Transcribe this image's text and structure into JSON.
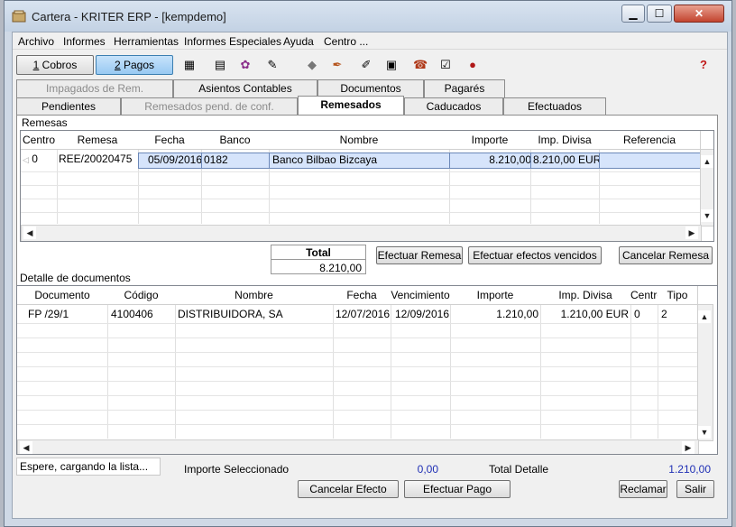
{
  "window": {
    "title": "Cartera - KRITER ERP - [kempdemo]"
  },
  "menu": [
    "Archivo",
    "Informes",
    "Herramientas",
    "Informes Especiales",
    "Ayuda",
    "Centro ..."
  ],
  "toolbar": {
    "cobros_num": "1",
    "cobros_label": " Cobros",
    "pagos_num": "2",
    "pagos_label": " Pagos"
  },
  "tabs_row1": [
    "Impagados de Rem.",
    "Asientos Contables",
    "Documentos",
    "Pagarés"
  ],
  "tabs_row2": [
    "Pendientes",
    "Remesados pend. de conf.",
    "Remesados",
    "Caducados",
    "Efectuados"
  ],
  "remesas": {
    "section_title": "Remesas",
    "columns": [
      "Centro",
      "Remesa",
      "Fecha",
      "Banco",
      "Nombre",
      "Importe",
      "Imp. Divisa",
      "Referencia"
    ],
    "rows": [
      {
        "centro": "0",
        "remesa": "REE/20020475",
        "fecha": "05/09/2016",
        "banco": "0182",
        "nombre": "Banco Bilbao Bizcaya",
        "importe": "8.210,00",
        "imp_divisa": "8.210,00 EUR",
        "referencia": ""
      }
    ],
    "total_label": "Total",
    "total_value": "8.210,00",
    "btn_efectuar_remesa": "Efectuar Remesa",
    "btn_efectuar_vencidos": "Efectuar efectos vencidos",
    "btn_cancelar_remesa": "Cancelar Remesa"
  },
  "detalle": {
    "section_title": "Detalle de documentos",
    "columns": [
      "Documento",
      "Código",
      "Nombre",
      "Fecha",
      "Vencimiento",
      "Importe",
      "Imp. Divisa",
      "Centro",
      "Tipo"
    ],
    "rows": [
      {
        "documento": "FP /29/1",
        "codigo": "4100406",
        "nombre": "DISTRIBUIDORA, SA",
        "fecha": "12/07/2016",
        "vencimiento": "12/09/2016",
        "importe": "1.210,00",
        "imp_divisa": "1.210,00 EUR",
        "centro": "0",
        "tipo": "2"
      }
    ]
  },
  "footer": {
    "status_text": "Espere, cargando la lista...",
    "importe_sel_label": "Importe Seleccionado",
    "importe_sel_value": "0,00",
    "total_detalle_label": "Total Detalle",
    "total_detalle_value": "1.210,00",
    "btn_cancelar_efecto": "Cancelar Efecto",
    "btn_efectuar_pago": "Efectuar Pago",
    "btn_reclamar": "Reclamar",
    "btn_salir": "Salir"
  },
  "icons": [
    "table-icon",
    "calculator-icon",
    "clipboard-icon",
    "edit-icon",
    "eraser-icon",
    "pen-icon",
    "pencil-icon",
    "list-icon",
    "print-icon",
    "checklist-icon",
    "mouse-icon",
    "help-icon"
  ]
}
